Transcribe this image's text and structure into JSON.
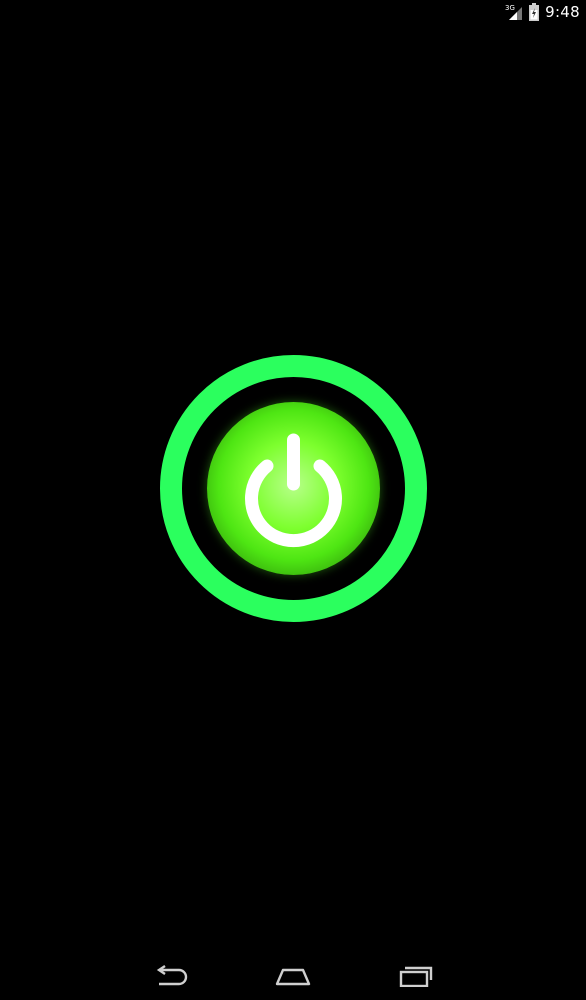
{
  "status_bar": {
    "network_label": "3G",
    "time": "9:48",
    "icons": [
      "signal-icon",
      "battery-icon"
    ]
  },
  "main": {
    "power_button": {
      "icon": "power-icon",
      "ring_color": "#2bff5e",
      "glow_color": "#7dff2e"
    }
  },
  "nav_bar": {
    "icons": [
      "back-icon",
      "home-icon",
      "recent-apps-icon"
    ]
  }
}
